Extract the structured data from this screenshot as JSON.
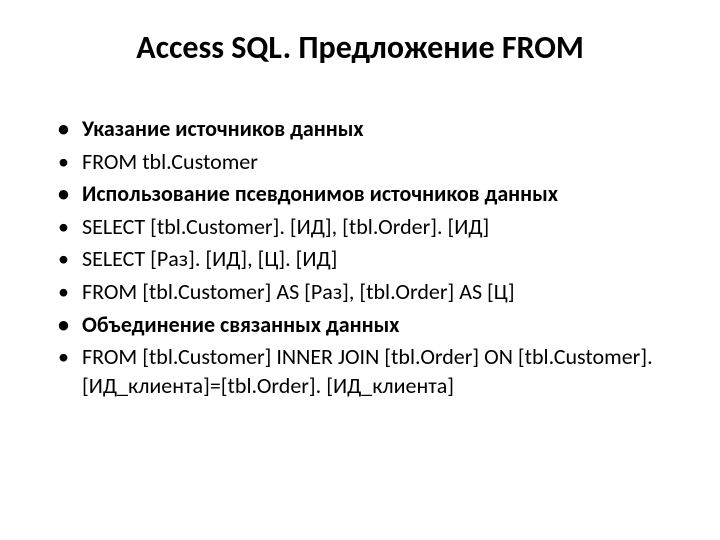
{
  "title": "Access SQL. Предложение FROM",
  "bullets": [
    {
      "text": "Указание источников данных",
      "bold": true
    },
    {
      "text": "FROM tbl.Customer",
      "bold": false
    },
    {
      "text": "Использование псевдонимов источников данных",
      "bold": true
    },
    {
      "text": "SELECT [tbl.Customer]. [ИД], [tbl.Order]. [ИД]",
      "bold": false
    },
    {
      "text": "SELECT [Раз]. [ИД], [Ц]. [ИД]",
      "bold": false
    },
    {
      "text": "FROM [tbl.Customer] AS [Раз], [tbl.Order] AS [Ц]",
      "bold": false
    },
    {
      "text": "Объединение связанных данных",
      "bold": true
    },
    {
      "text": "FROM [tbl.Customer] INNER JOIN [tbl.Order] ON [tbl.Customer]. [ИД_клиента]=[tbl.Order]. [ИД_клиента]",
      "bold": false
    }
  ]
}
